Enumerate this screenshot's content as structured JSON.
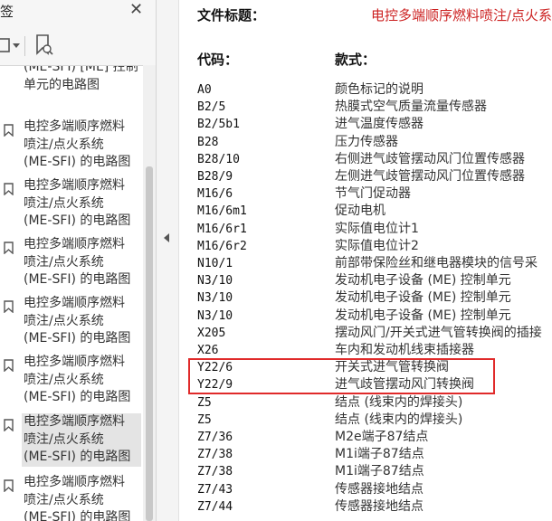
{
  "panel": {
    "title": "签",
    "items": [
      {
        "text": "(ME-SFI) [ME] 控制\n单元的电路图",
        "partial": true
      },
      {
        "text": "电控多端顺序燃料\n喷注/点火系统\n(ME-SFI) 的电路图"
      },
      {
        "text": "电控多端顺序燃料\n喷注/点火系统\n(ME-SFI) 的电路图"
      },
      {
        "text": "电控多端顺序燃料\n喷注/点火系统\n(ME-SFI) 的电路图"
      },
      {
        "text": "电控多端顺序燃料\n喷注/点火系统\n(ME-SFI) 的电路图"
      },
      {
        "text": "电控多端顺序燃料\n喷注/点火系统\n(ME-SFI) 的电路图"
      },
      {
        "text": "电控多端顺序燃料\n喷注/点火系统\n(ME-SFI) 的电路图",
        "selected": true
      },
      {
        "text": "电控多端顺序燃料\n喷注/点火系统\n(ME-SFI) 的电路图"
      }
    ]
  },
  "doc": {
    "title_label": "文件标题：",
    "title_value": "电控多端顺序燃料喷注/点火系统",
    "code_header": "代码：",
    "desc_header": "款式：",
    "rows": [
      {
        "code": "A0",
        "desc": "颜色标记的说明"
      },
      {
        "code": "B2/5",
        "desc": "热膜式空气质量流量传感器"
      },
      {
        "code": "B2/5b1",
        "desc": "进气温度传感器"
      },
      {
        "code": "B28",
        "desc": "压力传感器"
      },
      {
        "code": "B28/10",
        "desc": "右侧进气歧管摆动风门位置传感器"
      },
      {
        "code": "B28/9",
        "desc": "左侧进气歧管摆动风门位置传感器"
      },
      {
        "code": "M16/6",
        "desc": "节气门促动器"
      },
      {
        "code": "M16/6m1",
        "desc": "促动电机"
      },
      {
        "code": "M16/6r1",
        "desc": "实际值电位计1"
      },
      {
        "code": "M16/6r2",
        "desc": "实际值电位计2"
      },
      {
        "code": "N10/1",
        "desc": "前部带保险丝和继电器模块的信号采"
      },
      {
        "code": "N3/10",
        "desc": "发动机电子设备 (ME) 控制单元"
      },
      {
        "code": "N3/10",
        "desc": "发动机电子设备 (ME) 控制单元"
      },
      {
        "code": "N3/10",
        "desc": "发动机电子设备 (ME) 控制单元"
      },
      {
        "code": "X205",
        "desc": "摆动风门/开关式进气管转换阀的插接"
      },
      {
        "code": "X26",
        "desc": "车内和发动机线束插接器"
      },
      {
        "code": "Y22/6",
        "desc": "开关式进气管转换阀"
      },
      {
        "code": "Y22/9",
        "desc": "进气歧管摆动风门转换阀"
      },
      {
        "code": "Z5",
        "desc": "结点 (线束内的焊接头)"
      },
      {
        "code": "Z5",
        "desc": "结点 (线束内的焊接头)"
      },
      {
        "code": "Z7/36",
        "desc": "M2e端子87结点"
      },
      {
        "code": "Z7/38",
        "desc": "M1i端子87结点"
      },
      {
        "code": "Z7/38",
        "desc": "M1i端子87结点"
      },
      {
        "code": "Z7/43",
        "desc": "传感器接地结点"
      },
      {
        "code": "Z7/44",
        "desc": "传感器接地结点"
      }
    ]
  },
  "colors": {
    "title_value": "#cc2222",
    "highlight": "#e02a2a",
    "selected_bg": "#e4e4e4"
  },
  "icons": {
    "close": "close-icon",
    "options": "options-icon",
    "bookmark_add": "bookmark-add-icon",
    "bookmark": "bookmark-icon",
    "collapse": "collapse-left-icon"
  }
}
